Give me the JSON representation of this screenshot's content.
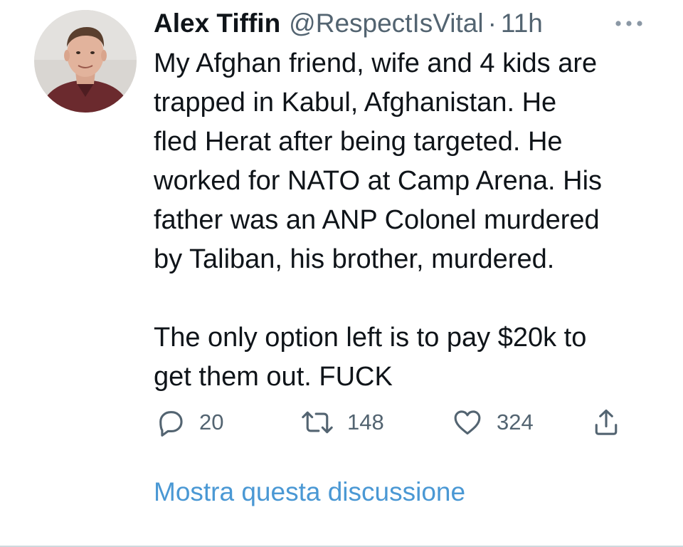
{
  "tweet": {
    "author": {
      "display_name": "Alex Tiffin",
      "handle": "@RespectIsVital"
    },
    "separator": "·",
    "time": "11h",
    "more_icon": "more-horizontal-icon",
    "text": "My Afghan friend, wife and 4 kids are\ntrapped in Kabul, Afghanistan. He\nfled Herat after being targeted. He\nworked for NATO at Camp Arena. His\nfather was an ANP Colonel murdered\nby Taliban, his brother, murdered.\n\nThe only option left is to pay $20k to\nget them out. FUCK",
    "actions": {
      "reply": {
        "icon": "reply-icon",
        "count": "20"
      },
      "retweet": {
        "icon": "retweet-icon",
        "count": "148"
      },
      "like": {
        "icon": "heart-icon",
        "count": "324"
      },
      "share": {
        "icon": "share-icon"
      }
    },
    "show_thread_label": "Mostra questa discussione"
  },
  "colors": {
    "text_primary": "#0f1419",
    "text_secondary": "#536471",
    "link": "#4a98d4"
  }
}
